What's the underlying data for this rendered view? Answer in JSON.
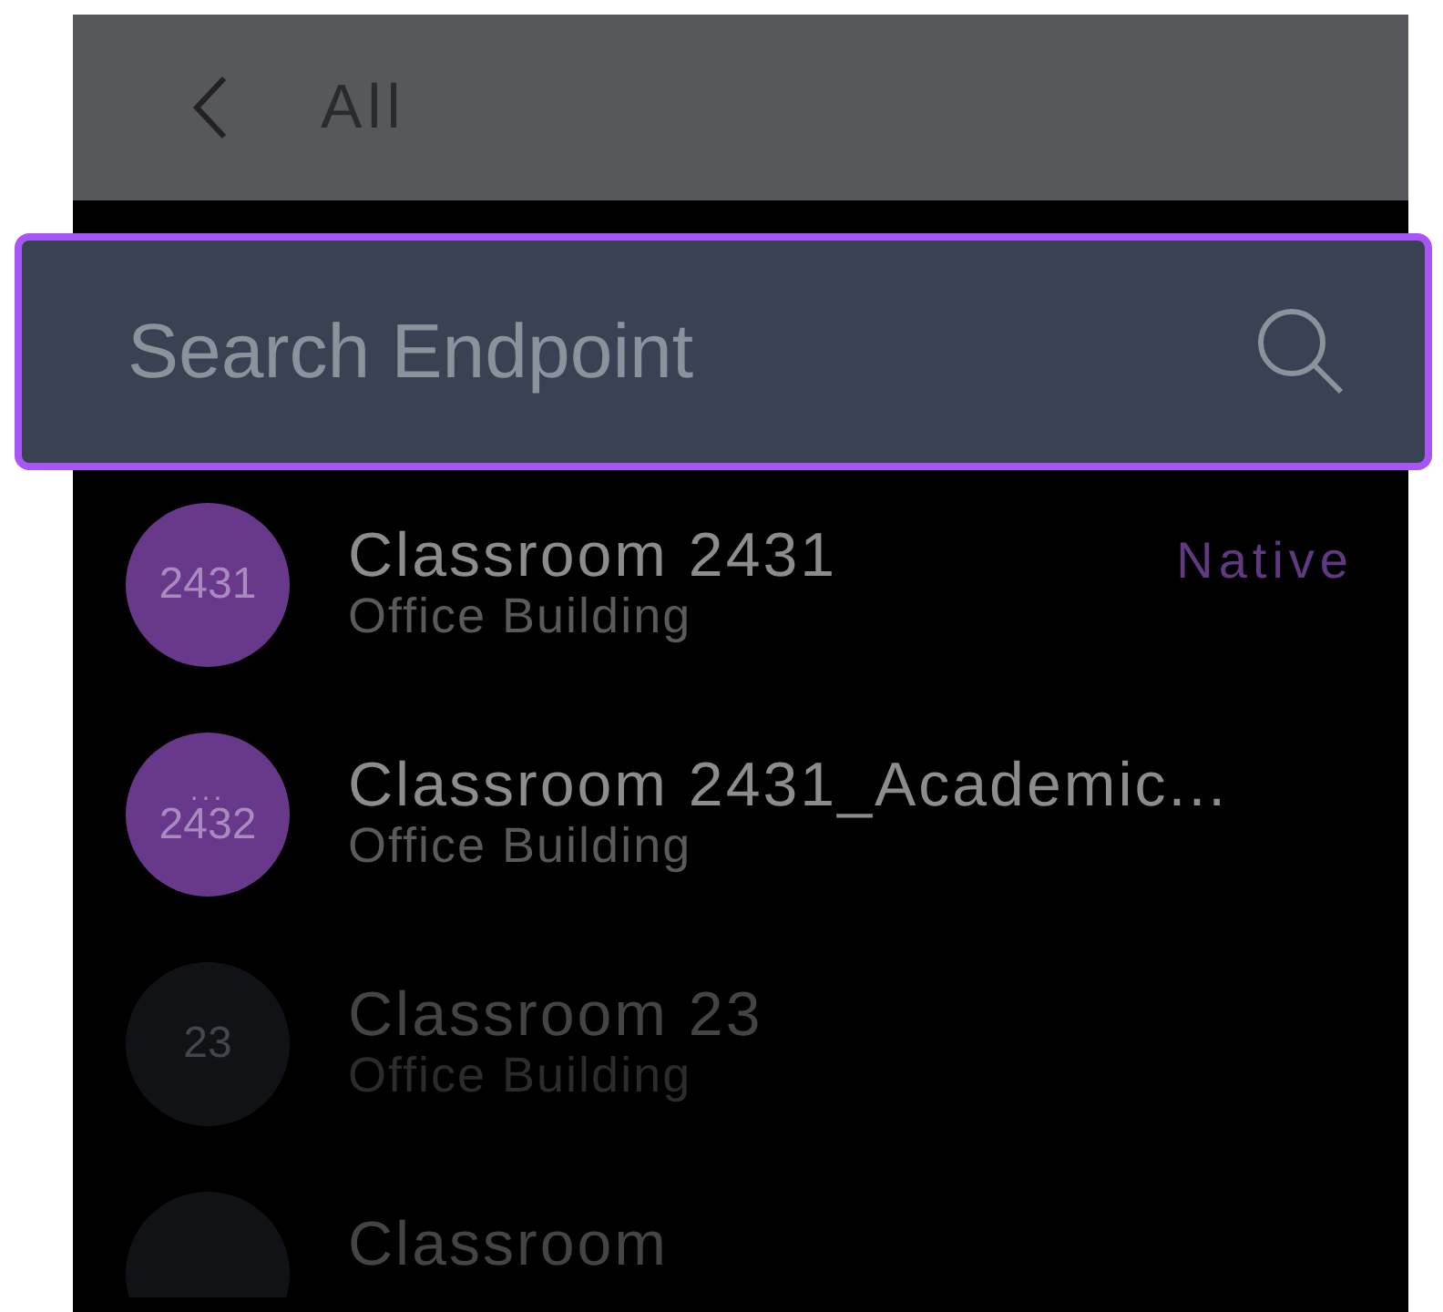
{
  "header": {
    "title": "All"
  },
  "search": {
    "placeholder": "Search Endpoint"
  },
  "endpoints": [
    {
      "avatar": "2431",
      "title": "Classroom 2431",
      "subtitle": "Office Building",
      "tag": "Native",
      "disabled": false
    },
    {
      "avatar": "2432",
      "avatar_dots": "...",
      "title": "Classroom 2431_Academic...",
      "subtitle": "Office Building",
      "disabled": false
    },
    {
      "avatar": "23",
      "title": "Classroom 23",
      "subtitle": "Office Building",
      "disabled": true
    },
    {
      "title": "Classroom",
      "disabled": true
    }
  ]
}
